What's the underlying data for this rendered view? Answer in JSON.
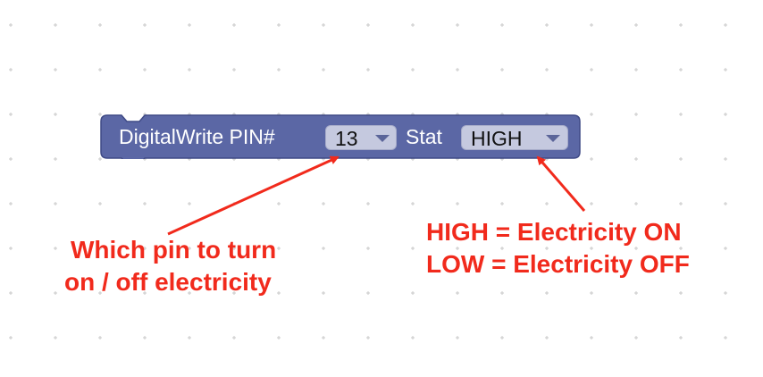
{
  "block": {
    "label": "DigitalWrite PIN#",
    "pin_value": "13",
    "stat_label": "Stat",
    "stat_value": "HIGH",
    "color": "#5b67a5",
    "border_color": "#3f4a86",
    "field_color": "#c5c9df"
  },
  "annotations": {
    "pin_note_line1": "Which pin to turn",
    "pin_note_line2": "on / off electricity",
    "high_note": "HIGH = Electricity ON",
    "low_note": "LOW = Electricity OFF",
    "color": "#f12a1c"
  },
  "icons": {
    "dropdown": "chevron-down-icon",
    "arrow": "annotation-arrow-icon"
  }
}
